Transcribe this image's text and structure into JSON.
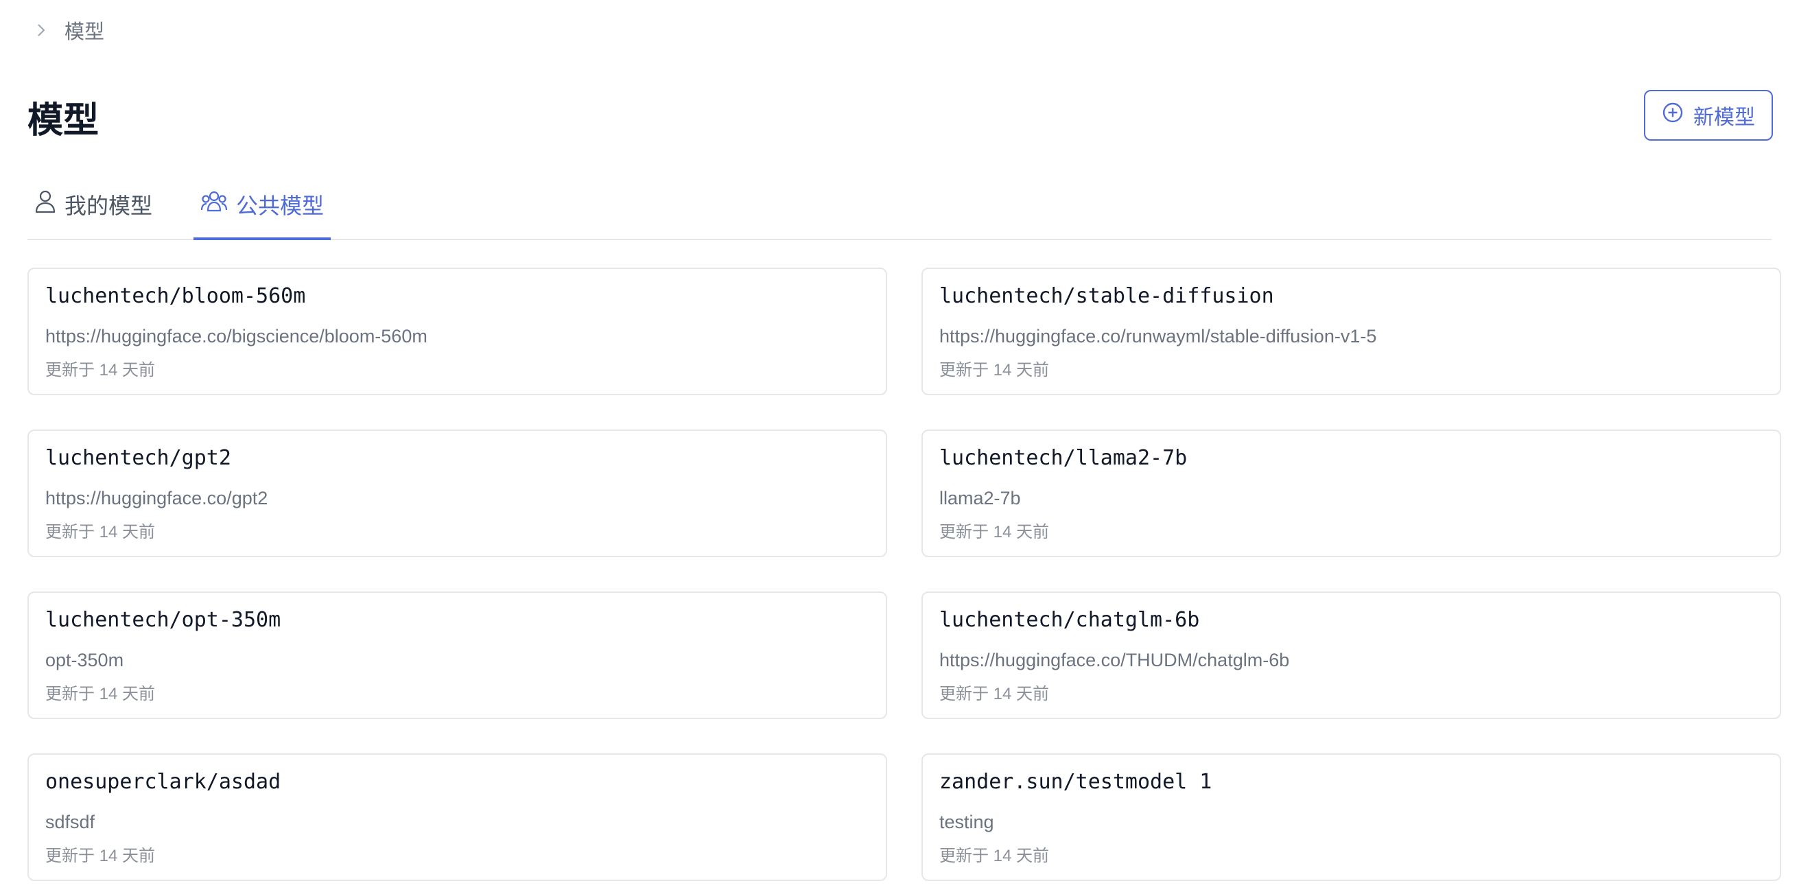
{
  "breadcrumb": {
    "current": "模型"
  },
  "header": {
    "title": "模型",
    "new_button": "新模型"
  },
  "tabs": [
    {
      "label": "我的模型",
      "icon": "user-icon",
      "active": false
    },
    {
      "label": "公共模型",
      "icon": "users-icon",
      "active": true
    }
  ],
  "models": [
    {
      "name": "luchentech/bloom-560m",
      "description": "https://huggingface.co/bigscience/bloom-560m",
      "updated": "更新于 14 天前"
    },
    {
      "name": "luchentech/stable-diffusion",
      "description": "https://huggingface.co/runwayml/stable-diffusion-v1-5",
      "updated": "更新于 14 天前"
    },
    {
      "name": "luchentech/gpt2",
      "description": "https://huggingface.co/gpt2",
      "updated": "更新于 14 天前"
    },
    {
      "name": "luchentech/llama2-7b",
      "description": "llama2-7b",
      "updated": "更新于 14 天前"
    },
    {
      "name": "luchentech/opt-350m",
      "description": "opt-350m",
      "updated": "更新于 14 天前"
    },
    {
      "name": "luchentech/chatglm-6b",
      "description": "https://huggingface.co/THUDM/chatglm-6b",
      "updated": "更新于 14 天前"
    },
    {
      "name": "onesuperclark/asdad",
      "description": "sdfsdf",
      "updated": "更新于 14 天前"
    },
    {
      "name": "zander.sun/testmodel 1",
      "description": "testing",
      "updated": "更新于 14 天前"
    }
  ],
  "colors": {
    "accent": "#4f6bd8",
    "border": "#e5e7eb",
    "muted_text": "#6b7280"
  }
}
